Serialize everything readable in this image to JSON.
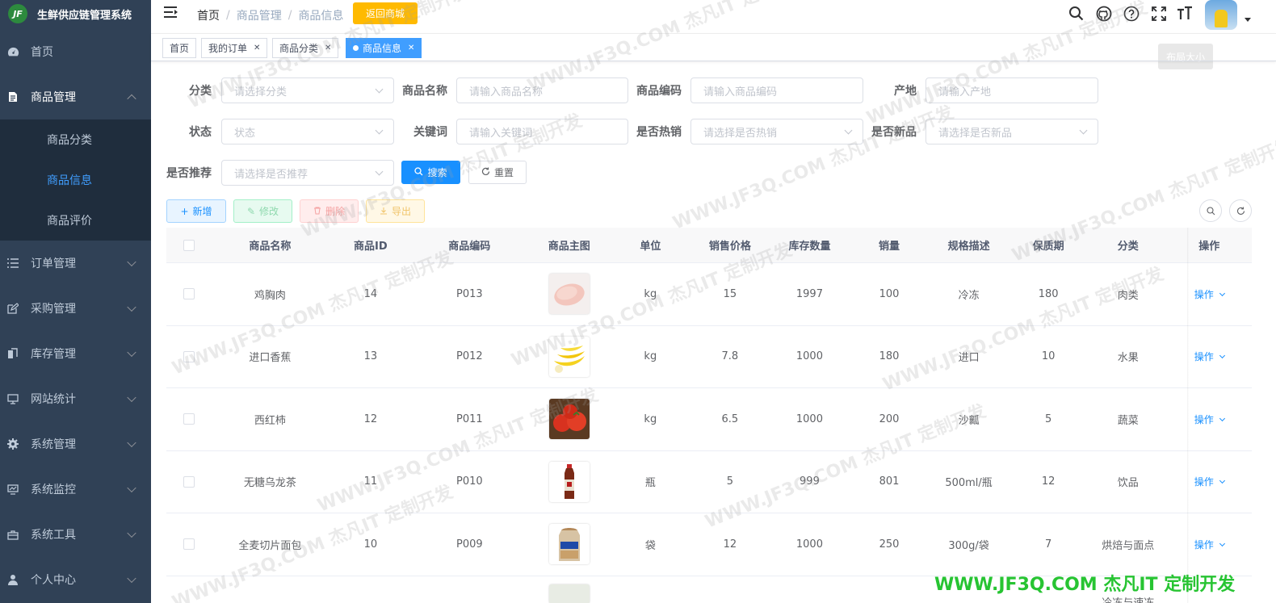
{
  "app": {
    "title": "生鲜供应链管理系统",
    "logo_text": "JF"
  },
  "sidebar": {
    "items": [
      {
        "label": "首页",
        "icon": "dashboard-icon"
      },
      {
        "label": "商品管理",
        "icon": "document-icon",
        "expanded": true,
        "children": [
          {
            "label": "商品分类"
          },
          {
            "label": "商品信息",
            "active": true
          },
          {
            "label": "商品评价"
          }
        ]
      },
      {
        "label": "订单管理",
        "icon": "list-icon"
      },
      {
        "label": "采购管理",
        "icon": "edit-icon"
      },
      {
        "label": "库存管理",
        "icon": "copy-icon"
      },
      {
        "label": "网站统计",
        "icon": "monitor-icon"
      },
      {
        "label": "系统管理",
        "icon": "gear-icon"
      },
      {
        "label": "系统监控",
        "icon": "monitor-chart-icon"
      },
      {
        "label": "系统工具",
        "icon": "toolbox-icon"
      },
      {
        "label": "个人中心",
        "icon": "user-icon"
      }
    ]
  },
  "header": {
    "breadcrumb": [
      "首页",
      "商品管理",
      "商品信息"
    ],
    "back_button": "返回商城",
    "tooltip": "布局大小"
  },
  "tags": [
    {
      "label": "首页",
      "closable": false
    },
    {
      "label": "我的订单",
      "closable": true
    },
    {
      "label": "商品分类",
      "closable": true
    },
    {
      "label": "商品信息",
      "closable": true,
      "active": true
    }
  ],
  "form": {
    "category": {
      "label": "分类",
      "placeholder": "请选择分类"
    },
    "name": {
      "label": "商品名称",
      "placeholder": "请输入商品名称"
    },
    "code": {
      "label": "商品编码",
      "placeholder": "请输入商品编码"
    },
    "origin": {
      "label": "产地",
      "placeholder": "请输入产地"
    },
    "status": {
      "label": "状态",
      "placeholder": "状态"
    },
    "keyword": {
      "label": "关键词",
      "placeholder": "请输入关键词"
    },
    "hot": {
      "label": "是否热销",
      "placeholder": "请选择是否热销"
    },
    "new": {
      "label": "是否新品",
      "placeholder": "请选择是否新品"
    },
    "recommend": {
      "label": "是否推荐",
      "placeholder": "请选择是否推荐"
    },
    "search_button": "搜索",
    "reset_button": "重置"
  },
  "toolbar": {
    "add": "新增",
    "edit": "修改",
    "delete": "删除",
    "export": "导出"
  },
  "table": {
    "columns": [
      "商品名称",
      "商品ID",
      "商品编码",
      "商品主图",
      "单位",
      "销售价格",
      "库存数量",
      "销量",
      "规格描述",
      "保质期",
      "分类",
      "操作"
    ],
    "rows": [
      {
        "name": "鸡胸肉",
        "id": "14",
        "code": "P013",
        "image": "chicken-breast",
        "unit": "kg",
        "price": "15",
        "stock": "1997",
        "sales": "100",
        "spec": "冷冻",
        "shelf": "180",
        "category": "肉类",
        "action": "操作"
      },
      {
        "name": "进口香蕉",
        "id": "13",
        "code": "P012",
        "image": "banana",
        "unit": "kg",
        "price": "7.8",
        "stock": "1000",
        "sales": "180",
        "spec": "进口",
        "shelf": "10",
        "category": "水果",
        "action": "操作"
      },
      {
        "name": "西红柿",
        "id": "12",
        "code": "P011",
        "image": "tomato",
        "unit": "kg",
        "price": "6.5",
        "stock": "1000",
        "sales": "200",
        "spec": "沙瓤",
        "shelf": "5",
        "category": "蔬菜",
        "action": "操作"
      },
      {
        "name": "无糖乌龙茶",
        "id": "11",
        "code": "P010",
        "image": "tea-bottle",
        "unit": "瓶",
        "price": "5",
        "stock": "999",
        "sales": "801",
        "spec": "500ml/瓶",
        "shelf": "12",
        "category": "饮品",
        "action": "操作"
      },
      {
        "name": "全麦切片面包",
        "id": "10",
        "code": "P009",
        "image": "bread",
        "unit": "袋",
        "price": "12",
        "stock": "1000",
        "sales": "250",
        "spec": "300g/袋",
        "shelf": "7",
        "category": "烘焙与面点",
        "action": "操作"
      }
    ],
    "partial_row_text": "冷冻与速冻"
  },
  "watermark": "WWW.JF3Q.COM 杰凡IT 定制开发",
  "brand_footer": "WWW.JF3Q.COM 杰凡IT  定制开发",
  "colors": {
    "sidebar_bg": "#304156",
    "submenu_bg": "#1f2d3d",
    "primary": "#1890ff",
    "back_btn": "#ffba00",
    "brand_green": "#27c432"
  }
}
